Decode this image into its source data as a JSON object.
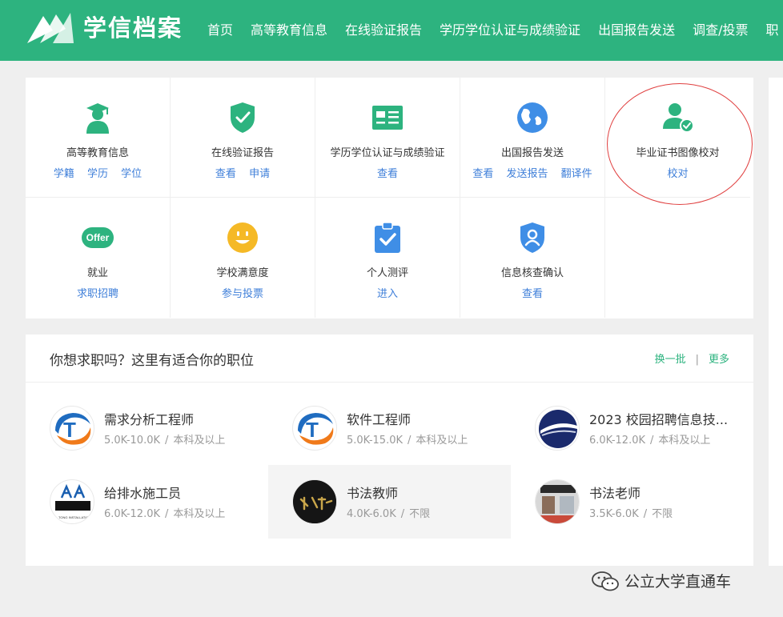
{
  "header": {
    "logo_text": "学信档案",
    "nav": [
      "首页",
      "高等教育信息",
      "在线验证报告",
      "学历学位认证与成绩验证",
      "出国报告发送",
      "调查/投票",
      "职"
    ]
  },
  "services": [
    {
      "title": "高等教育信息",
      "icon": "graduate-icon",
      "links": [
        "学籍",
        "学历",
        "学位"
      ]
    },
    {
      "title": "在线验证报告",
      "icon": "shield-check-icon",
      "links": [
        "查看",
        "申请"
      ]
    },
    {
      "title": "学历学位认证与成绩验证",
      "icon": "id-card-icon",
      "links": [
        "查看"
      ]
    },
    {
      "title": "出国报告发送",
      "icon": "globe-icon",
      "links": [
        "查看",
        "发送报告",
        "翻译件"
      ]
    },
    {
      "title": "毕业证书图像校对",
      "icon": "user-check-icon",
      "links": [
        "校对"
      ]
    },
    {
      "title": "就业",
      "icon": "offer-icon",
      "badge": "Offer",
      "links": [
        "求职招聘"
      ]
    },
    {
      "title": "学校满意度",
      "icon": "smiley-icon",
      "links": [
        "参与投票"
      ]
    },
    {
      "title": "个人测评",
      "icon": "clipboard-check-icon",
      "links": [
        "进入"
      ]
    },
    {
      "title": "信息核查确认",
      "icon": "shield-user-icon",
      "links": [
        "查看"
      ]
    }
  ],
  "jobs": {
    "title": "你想求职吗？这里有适合你的职位",
    "refresh": "换一批",
    "separator": "|",
    "more": "更多",
    "list": [
      {
        "title": "需求分析工程师",
        "salary": "5.0K-10.0K",
        "edu": "本科及以上"
      },
      {
        "title": "软件工程师",
        "salary": "5.0K-15.0K",
        "edu": "本科及以上"
      },
      {
        "title": "2023 校园招聘信息技...",
        "salary": "6.0K-12.0K",
        "edu": "本科及以上"
      },
      {
        "title": "给排水施工员",
        "salary": "6.0K-12.0K",
        "edu": "本科及以上",
        "logo_caption": "TONG INSTALLATION"
      },
      {
        "title": "书法教师",
        "salary": "4.0K-6.0K",
        "edu": "不限"
      },
      {
        "title": "书法老师",
        "salary": "3.5K-6.0K",
        "edu": "不限"
      }
    ],
    "meta_sep": "/"
  },
  "watermark": "公立大学直通车",
  "colors": {
    "brand": "#2db37f",
    "link": "#3f7fd9",
    "annotation": "#e04040"
  }
}
